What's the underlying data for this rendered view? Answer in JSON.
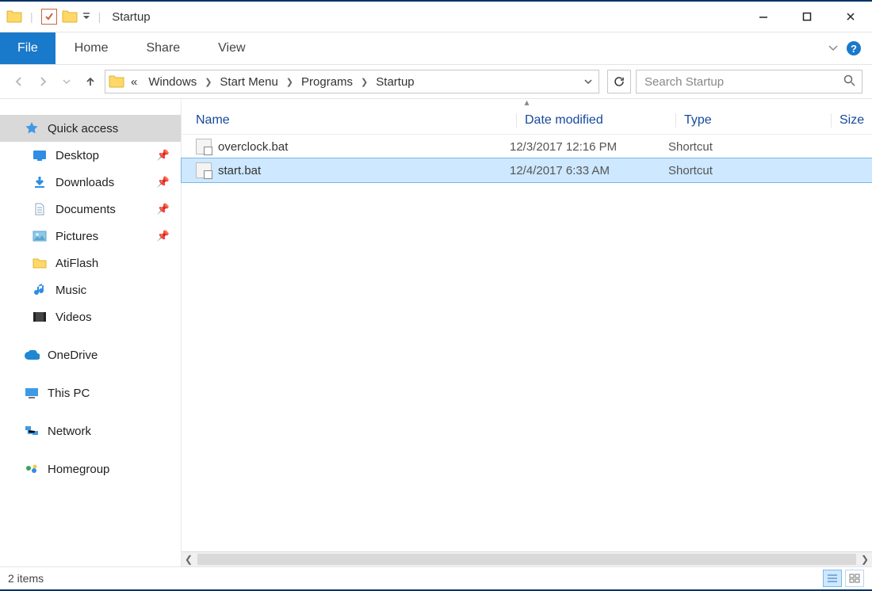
{
  "titlebar": {
    "title": "Startup"
  },
  "ribbon": {
    "file": "File",
    "tabs": [
      "Home",
      "Share",
      "View"
    ]
  },
  "address": {
    "prefix": "«",
    "crumbs": [
      "Windows",
      "Start Menu",
      "Programs",
      "Startup"
    ]
  },
  "search": {
    "placeholder": "Search Startup"
  },
  "navpane": {
    "quick_access": "Quick access",
    "pinned": [
      {
        "label": "Desktop",
        "icon": "desktop",
        "pin": true
      },
      {
        "label": "Downloads",
        "icon": "downloads",
        "pin": true
      },
      {
        "label": "Documents",
        "icon": "documents",
        "pin": true
      },
      {
        "label": "Pictures",
        "icon": "pictures",
        "pin": true
      },
      {
        "label": "AtiFlash",
        "icon": "folder",
        "pin": false
      },
      {
        "label": "Music",
        "icon": "music",
        "pin": false
      },
      {
        "label": "Videos",
        "icon": "videos",
        "pin": false
      }
    ],
    "roots": [
      {
        "label": "OneDrive",
        "icon": "onedrive"
      },
      {
        "label": "This PC",
        "icon": "thispc"
      },
      {
        "label": "Network",
        "icon": "network"
      },
      {
        "label": "Homegroup",
        "icon": "homegroup"
      }
    ]
  },
  "columns": {
    "name": "Name",
    "date": "Date modified",
    "type": "Type",
    "size": "Size"
  },
  "files": [
    {
      "name": "overclock.bat",
      "date": "12/3/2017 12:16 PM",
      "type": "Shortcut",
      "size": "",
      "selected": false
    },
    {
      "name": "start.bat",
      "date": "12/4/2017 6:33 AM",
      "type": "Shortcut",
      "size": "",
      "selected": true
    }
  ],
  "status": {
    "text": "2 items"
  }
}
